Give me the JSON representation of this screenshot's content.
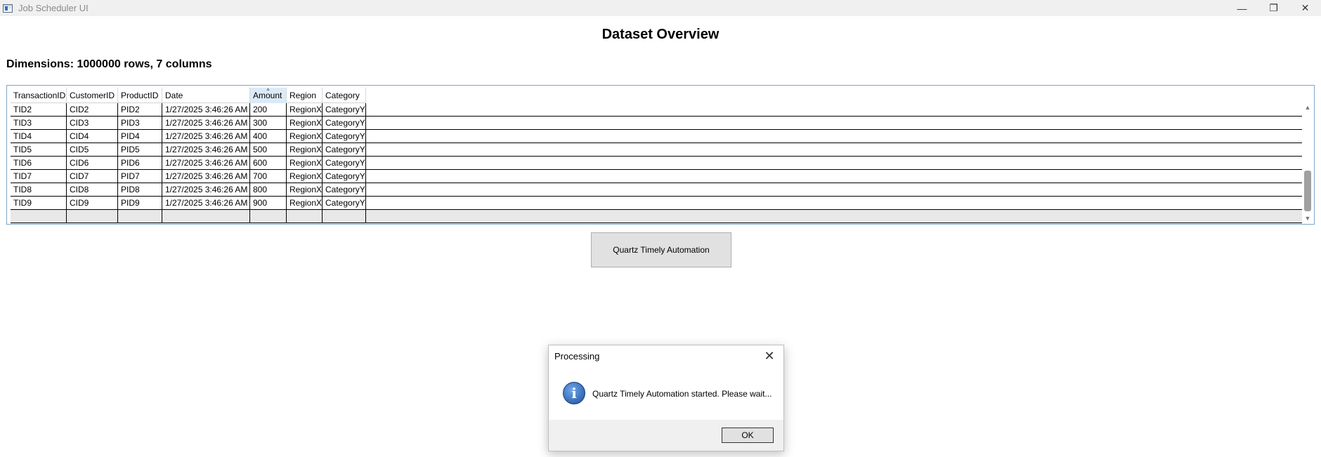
{
  "window": {
    "title": "Job Scheduler UI",
    "minimize": "—",
    "restore": "❐",
    "close": "✕"
  },
  "page": {
    "title": "Dataset Overview",
    "dimensions": "Dimensions: 1000000 rows, 7 columns"
  },
  "grid": {
    "columns": [
      "TransactionID",
      "CustomerID",
      "ProductID",
      "Date",
      "Amount",
      "Region",
      "Category"
    ],
    "sorted_column": "Amount",
    "rows": [
      [
        "TID2",
        "CID2",
        "PID2",
        "1/27/2025 3:46:26 AM",
        "200",
        "RegionX",
        "CategoryY"
      ],
      [
        "TID3",
        "CID3",
        "PID3",
        "1/27/2025 3:46:26 AM",
        "300",
        "RegionX",
        "CategoryY"
      ],
      [
        "TID4",
        "CID4",
        "PID4",
        "1/27/2025 3:46:26 AM",
        "400",
        "RegionX",
        "CategoryY"
      ],
      [
        "TID5",
        "CID5",
        "PID5",
        "1/27/2025 3:46:26 AM",
        "500",
        "RegionX",
        "CategoryY"
      ],
      [
        "TID6",
        "CID6",
        "PID6",
        "1/27/2025 3:46:26 AM",
        "600",
        "RegionX",
        "CategoryY"
      ],
      [
        "TID7",
        "CID7",
        "PID7",
        "1/27/2025 3:46:26 AM",
        "700",
        "RegionX",
        "CategoryY"
      ],
      [
        "TID8",
        "CID8",
        "PID8",
        "1/27/2025 3:46:26 AM",
        "800",
        "RegionX",
        "CategoryY"
      ],
      [
        "TID9",
        "CID9",
        "PID9",
        "1/27/2025 3:46:26 AM",
        "900",
        "RegionX",
        "CategoryY"
      ]
    ]
  },
  "action": {
    "label": "Quartz Timely Automation"
  },
  "dialog": {
    "title": "Processing",
    "close": "✕",
    "icon": "info-icon",
    "icon_glyph": "i",
    "message": "Quartz Timely Automation started. Please wait...",
    "ok_label": "OK"
  }
}
